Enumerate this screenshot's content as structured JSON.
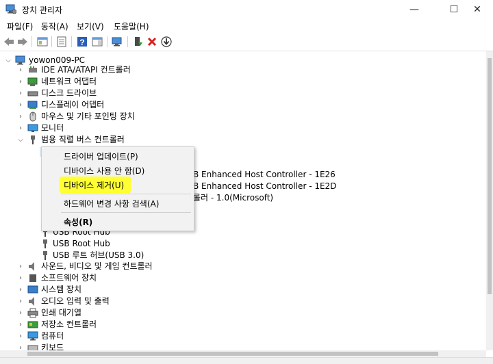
{
  "window": {
    "title": "장치 관리자",
    "minimize": "—",
    "maximize": "☐",
    "close": "✕"
  },
  "menubar": [
    "파일(F)",
    "동작(A)",
    "보기(V)",
    "도움말(H)"
  ],
  "tree": {
    "root": "yowon009-PC",
    "categories": [
      "IDE ATA/ATAPI 컨트롤러",
      "네트워크 어댑터",
      "디스크 드라이브",
      "디스플레이 어댑터",
      "마우스 및 기타 포인팅 장치",
      "모니터",
      "범용 직렬 버스 컨트롤러"
    ],
    "usb_children": [
      "B Enhanced Host Controller - 1E26",
      "B Enhanced Host Controller - 1E2D",
      "롤러 - 1.0(Microsoft)",
      "USB Root Hub",
      "USB Root Hub",
      "USB 루트 허브(USB 3.0)"
    ],
    "categories_after": [
      "사운드, 비디오 및 게임 컨트롤러",
      "소프트웨어 장치",
      "시스템 장치",
      "오디오 입력 및 출력",
      "인쇄 대기열",
      "저장소 컨트롤러",
      "컴퓨터",
      "키보드"
    ]
  },
  "context_menu": {
    "items": [
      "드라이버 업데이트(P)",
      "디바이스 사용 안 함(D)",
      "디바이스 제거(U)",
      "하드웨어 변경 사항 검색(A)",
      "속성(R)"
    ],
    "highlighted": "디바이스 제거(U)",
    "highlight_color": "#ffff33"
  },
  "colors": {
    "delete_red": "#d81e1e",
    "install_green": "#2e9b2e",
    "help_blue": "#2b5eb8"
  }
}
